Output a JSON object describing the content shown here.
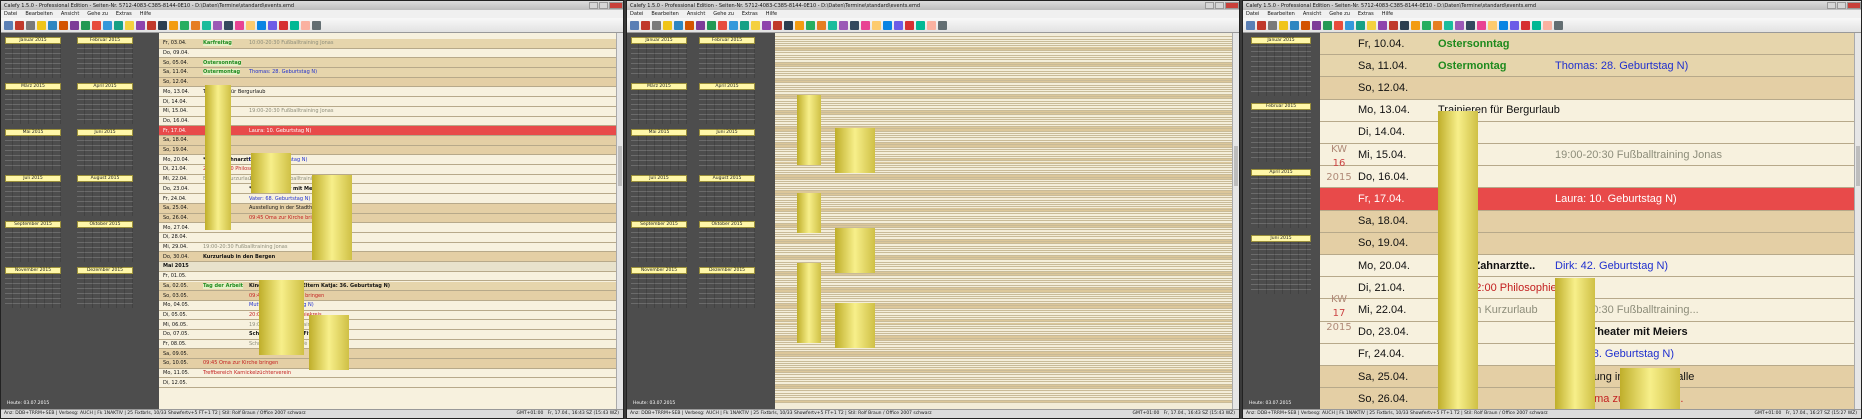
{
  "app": {
    "title": "Calefy 1.5.0 - Professional Edition - Seiten-Nr. 5712-4083-C385-8144-0E10 - D:\\Daten\\Termine\\standard\\events.emd",
    "menu": [
      "Datei",
      "Bearbeiten",
      "Ansicht",
      "Gehe zu",
      "Extras",
      "Hilfe"
    ],
    "today_label": "Heute: 03.07.2015",
    "status_left": "Anz: DDB+TRRM+SEB | Verbesg: AUCH | Fk 1NAKTIV | 25 Fixtbrls, 10/33 Showfertv+5 FT+1 T2 | Stil: Rolf Braun / Office 2007 schwarz",
    "status_right_1": "GMT+01:00",
    "status_right_2": "Fr, 17.04., 16:43 SZ (15:43 WZ)",
    "status_right_3": "Fr, 17.04., 16:27 SZ (15:27 WZ)",
    "month_labels": [
      "Januar 2015",
      "Februar 2015",
      "März 2015",
      "April 2015",
      "Mai 2015",
      "Juni 2015",
      "Juli 2015",
      "August 2015",
      "September 2015",
      "Oktober 2015",
      "November 2015",
      "Dezember 2015"
    ],
    "may_header": "Mai 2015"
  },
  "colors": {
    "accent": "#fff7a8",
    "weekend": "#e4cfa5",
    "highlight": "#e84a4a",
    "holiday": "#1e8a1e",
    "birthday": "#1f2fcf"
  },
  "w1_rows": [
    {
      "date": "Fr, 03.04.",
      "t1": "Karfreitag",
      "t2": "10:00-20:30 Fußballtraining Jonas",
      "cls": "hol",
      "c1": "holname",
      "c2": "train"
    },
    {
      "date": "Do, 09.04.",
      "t1": "",
      "t2": "",
      "cls": "",
      "c1": "",
      "c2": ""
    },
    {
      "date": "So, 05.04.",
      "t1": "Ostersonntag",
      "t2": "",
      "cls": "hol",
      "c1": "holname",
      "c2": ""
    },
    {
      "date": "Sa, 11.04.",
      "t1": "Ostermontag",
      "t2": "Thomas: 28. Geburtstag N)",
      "cls": "hol",
      "c1": "holname",
      "c2": "bday"
    },
    {
      "date": "So, 12.04.",
      "t1": "",
      "t2": "",
      "cls": "we",
      "c1": "",
      "c2": ""
    },
    {
      "date": "Mo, 13.04.",
      "t1": "Trainieren für Bergurlaub",
      "t2": "",
      "cls": "",
      "c1": "",
      "c2": ""
    },
    {
      "date": "Di, 14.04.",
      "t1": "",
      "t2": "",
      "cls": "",
      "c1": "",
      "c2": ""
    },
    {
      "date": "Mi, 15.04.",
      "t1": "",
      "t2": "19:00-20:30 Fußballtraining Jonas",
      "cls": "",
      "c1": "",
      "c2": "train"
    },
    {
      "date": "Do, 16.04.",
      "t1": "",
      "t2": "",
      "cls": "",
      "c1": "",
      "c2": ""
    },
    {
      "date": "Fr, 17.04.",
      "t1": "",
      "t2": "Laura: 10. Geburtstag N)",
      "cls": "red",
      "c1": "",
      "c2": ""
    },
    {
      "date": "Sa, 18.04.",
      "t1": "",
      "t2": "",
      "cls": "we",
      "c1": "",
      "c2": ""
    },
    {
      "date": "So, 19.04.",
      "t1": "",
      "t2": "",
      "cls": "we",
      "c1": "",
      "c2": ""
    },
    {
      "date": "Mo, 20.04.",
      "t1": "*08:00 Zahnarzttermin",
      "t2": "Dirk: 42. Geburtstag N)",
      "cls": "",
      "c1": "bold",
      "c2": "bday"
    },
    {
      "date": "Di, 21.04.",
      "t1": "20:00-22:00 Philosophiekreis",
      "t2": "",
      "cls": "",
      "c1": "red-txt",
      "c2": ""
    },
    {
      "date": "Mi, 22.04.",
      "t1": "Eltern im Kurzurlaub",
      "t2": "19:00-20:30 Fußballtraining Jonas",
      "cls": "",
      "c1": "train",
      "c2": "train"
    },
    {
      "date": "Do, 23.04.",
      "t1": "",
      "t2": "*20:00 Theater mit Meiers",
      "cls": "",
      "c1": "",
      "c2": "bold"
    },
    {
      "date": "Fr, 24.04.",
      "t1": "",
      "t2": "Vater: 68. Geburtstag N)",
      "cls": "",
      "c1": "",
      "c2": "bday"
    },
    {
      "date": "Sa, 25.04.",
      "t1": "",
      "t2": "Ausstellung in der Stadthalle",
      "cls": "we",
      "c1": "",
      "c2": ""
    },
    {
      "date": "So, 26.04.",
      "t1": "",
      "t2": "09:45 Oma zur Kirche bringen",
      "cls": "we",
      "c1": "",
      "c2": "red-txt"
    },
    {
      "date": "Mo, 27.04.",
      "t1": "",
      "t2": "",
      "cls": "",
      "c1": "",
      "c2": ""
    },
    {
      "date": "Di, 28.04.",
      "t1": "",
      "t2": "",
      "cls": "",
      "c1": "",
      "c2": ""
    },
    {
      "date": "Mi, 29.04.",
      "t1": "19:00-20:30 Fußballtraining Jonas",
      "t2": "",
      "cls": "",
      "c1": "train",
      "c2": ""
    },
    {
      "date": "Do, 30.04.",
      "t1": "Kurzurlaub in den Bergen",
      "t2": "",
      "cls": "we",
      "c1": "bold",
      "c2": ""
    },
    {
      "date": "Mai 2015",
      "t1": "",
      "t2": "",
      "cls": "monthsep",
      "c1": "",
      "c2": ""
    },
    {
      "date": "Fr, 01.05.",
      "t1": "",
      "t2": "",
      "cls": "",
      "c1": "",
      "c2": ""
    },
    {
      "date": "Sa, 02.05.",
      "t1": "Tag der Arbeit",
      "t2": "Kinder bei meinen Eltern    Katja: 36. Geburtstag N)",
      "cls": "hol",
      "c1": "holname",
      "c2": "bold"
    },
    {
      "date": "So, 03.05.",
      "t1": "",
      "t2": "09:45 Oma zur Kirche bringen",
      "cls": "we",
      "c1": "",
      "c2": "red-txt"
    },
    {
      "date": "Mo, 04.05.",
      "t1": "",
      "t2": "Mutter: 65. Geburtstag N)",
      "cls": "",
      "c1": "",
      "c2": "bday"
    },
    {
      "date": "Di, 05.05.",
      "t1": "",
      "t2": "20:00-22:00 Philosophiekreis",
      "cls": "",
      "c1": "",
      "c2": "red-txt"
    },
    {
      "date": "Mi, 06.05.",
      "t1": "",
      "t2": "19:00-20:30 Fußballtraining Jonas",
      "cls": "",
      "c1": "",
      "c2": "train"
    },
    {
      "date": "Do, 07.05.",
      "t1": "",
      "t2": "Schnuppertraining Fitness-Studio",
      "cls": "",
      "c1": "",
      "c2": "bold"
    },
    {
      "date": "Fr, 08.05.",
      "t1": "",
      "t2": "Schnupperkurs im Café d'Azur",
      "cls": "",
      "c1": "",
      "c2": "train"
    },
    {
      "date": "Sa, 09.05.",
      "t1": "",
      "t2": "",
      "cls": "we",
      "c1": "",
      "c2": ""
    },
    {
      "date": "So, 10.05.",
      "t1": "09:45 Oma zur Kirche bringen",
      "t2": "",
      "cls": "we",
      "c1": "red-txt",
      "c2": ""
    },
    {
      "date": "Mo, 11.05.",
      "t1": "Treffbereich Karnickelzüchterverein",
      "t2": "",
      "cls": "",
      "c1": "red-txt",
      "c2": ""
    },
    {
      "date": "Di, 12.05.",
      "t1": "",
      "t2": "",
      "cls": "",
      "c1": "",
      "c2": ""
    }
  ],
  "w3_rows": [
    {
      "date": "Fr, 10.04.",
      "t1": "Ostersonntag",
      "t2": "",
      "cls": "hol",
      "c1": "holname",
      "c2": ""
    },
    {
      "date": "Sa, 11.04.",
      "t1": "Ostermontag",
      "t2": "Thomas: 28. Geburtstag N)",
      "cls": "hol",
      "c1": "holname",
      "c2": "bday"
    },
    {
      "date": "So, 12.04.",
      "t1": "",
      "t2": "",
      "cls": "we",
      "c1": "",
      "c2": ""
    },
    {
      "date": "Mo, 13.04.",
      "t1": "Trainieren für Bergurlaub",
      "t2": "",
      "cls": "",
      "c1": "",
      "c2": ""
    },
    {
      "date": "Di, 14.04.",
      "t1": "",
      "t2": "",
      "cls": "",
      "c1": "",
      "c2": ""
    },
    {
      "date": "Mi, 15.04.",
      "t1": "",
      "t2": "19:00-20:30 Fußballtraining Jonas",
      "cls": "",
      "c1": "",
      "c2": "train"
    },
    {
      "date": "Do, 16.04.",
      "t1": "",
      "t2": "",
      "cls": "",
      "c1": "",
      "c2": ""
    },
    {
      "date": "Fr, 17.04.",
      "t1": "",
      "t2": "Laura: 10. Geburtstag N)",
      "cls": "red",
      "c1": "",
      "c2": ""
    },
    {
      "date": "Sa, 18.04.",
      "t1": "",
      "t2": "",
      "cls": "we",
      "c1": "",
      "c2": ""
    },
    {
      "date": "So, 19.04.",
      "t1": "",
      "t2": "",
      "cls": "we",
      "c1": "",
      "c2": ""
    },
    {
      "date": "Mo, 20.04.",
      "t1": "*08:00 Zahnarztte..",
      "t2": "Dirk: 42. Geburtstag N)",
      "cls": "",
      "c1": "bold",
      "c2": "bday"
    },
    {
      "date": "Di, 21.04.",
      "t1": "20:00-22:00 Philosophiekreis",
      "t2": "",
      "cls": "",
      "c1": "red-txt",
      "c2": ""
    },
    {
      "date": "Mi, 22.04.",
      "t1": "Eltern im Kurzurlaub",
      "t2": "19:00-20:30 Fußballtraining...",
      "cls": "",
      "c1": "train",
      "c2": "train"
    },
    {
      "date": "Do, 23.04.",
      "t1": "",
      "t2": "*20:00 Theater mit Meiers",
      "cls": "",
      "c1": "",
      "c2": "bold"
    },
    {
      "date": "Fr, 24.04.",
      "t1": "",
      "t2": "Vater: 68. Geburtstag N)",
      "cls": "",
      "c1": "",
      "c2": "bday"
    },
    {
      "date": "Sa, 25.04.",
      "t1": "",
      "t2": "Ausstellung in der Stadthalle",
      "cls": "we",
      "c1": "",
      "c2": ""
    },
    {
      "date": "So, 26.04.",
      "t1": "",
      "t2": "09:45 Oma zur Kirche br...",
      "cls": "we",
      "c1": "",
      "c2": "red-txt"
    }
  ],
  "w3_kw": [
    {
      "label": "KW",
      "num": "16",
      "year": "2015"
    },
    {
      "label": "KW",
      "num": "17",
      "year": "2015"
    }
  ]
}
